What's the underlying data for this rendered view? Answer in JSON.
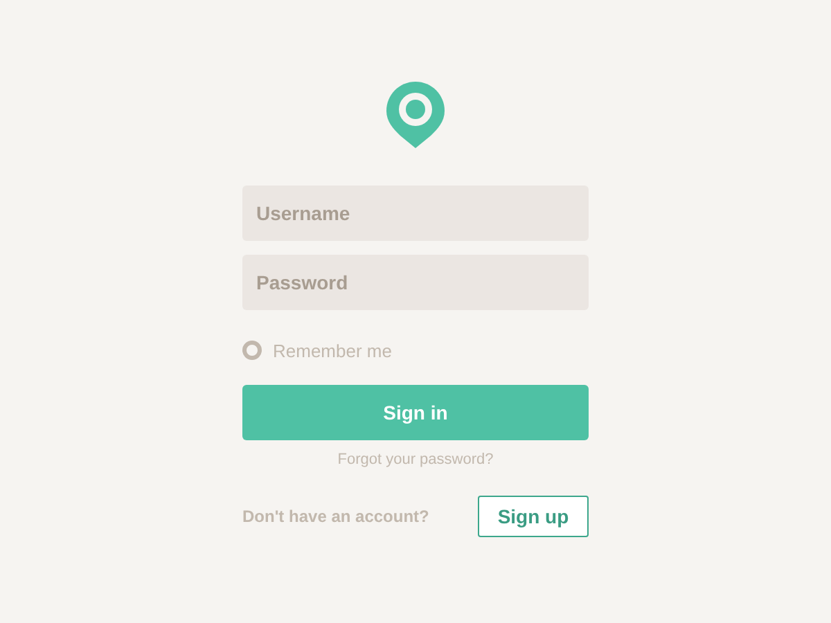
{
  "form": {
    "username": {
      "placeholder": "Username"
    },
    "password": {
      "placeholder": "Password"
    },
    "remember": {
      "label": "Remember me",
      "checked": false
    },
    "sign_in": "Sign in",
    "forgot": "Forgot your password?",
    "signup_prompt": "Don't have an account?",
    "sign_up": "Sign up"
  }
}
